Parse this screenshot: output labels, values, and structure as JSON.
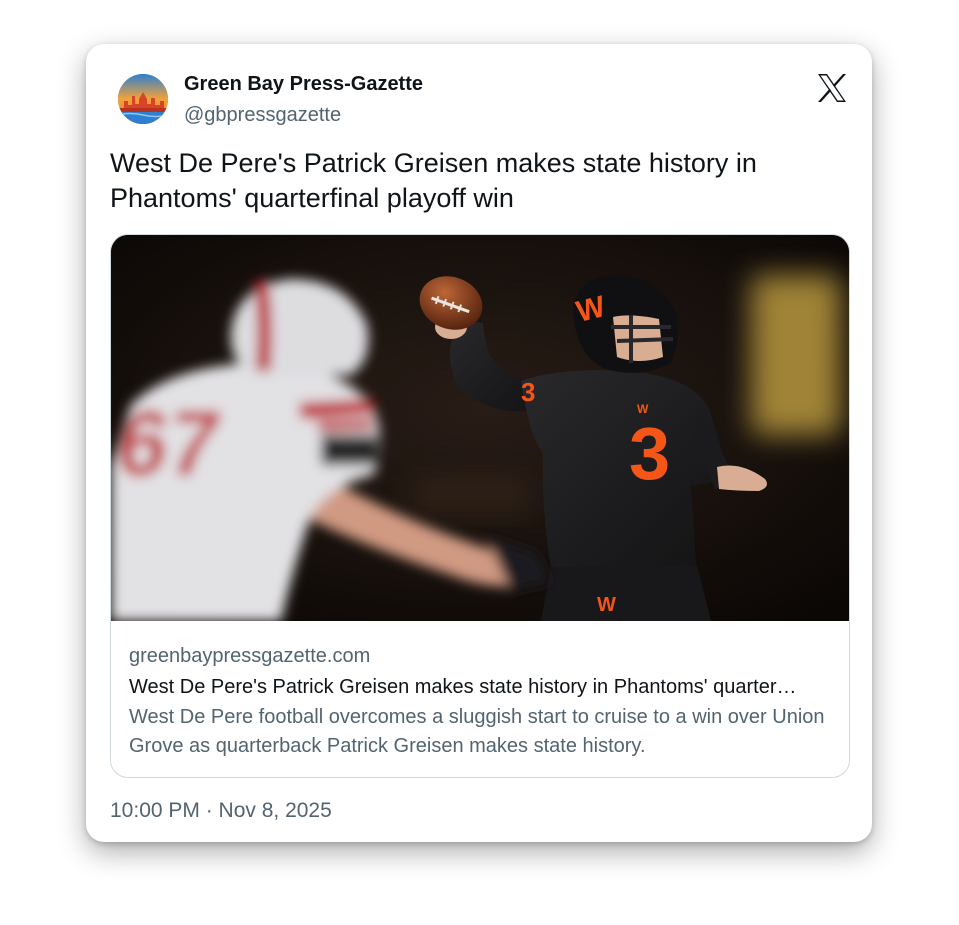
{
  "author": {
    "display_name": "Green Bay Press-Gazette",
    "handle": "@gbpressgazette",
    "avatar_icon": "city-skyline-logo-icon"
  },
  "platform_icon": "x-logo-icon",
  "tweet": {
    "text": "West De Pere's Patrick Greisen makes state history in Phantoms' quarterfinal playoff win"
  },
  "link_card": {
    "image_icon": "football-quarterback-photo",
    "domain": "greenbaypressgazette.com",
    "title": "West De Pere's Patrick Greisen makes state history in Phantoms' quarter…",
    "description": "West De Pere football overcomes a sluggish start to cruise to a win over Union Grove as quarterback Patrick Greisen makes state history."
  },
  "timestamp": "10:00 PM · Nov 8, 2025",
  "colors": {
    "text_primary": "#0f1419",
    "text_secondary": "#536471",
    "border": "#cfd9de",
    "accent_orange": "#ff5a1a"
  }
}
